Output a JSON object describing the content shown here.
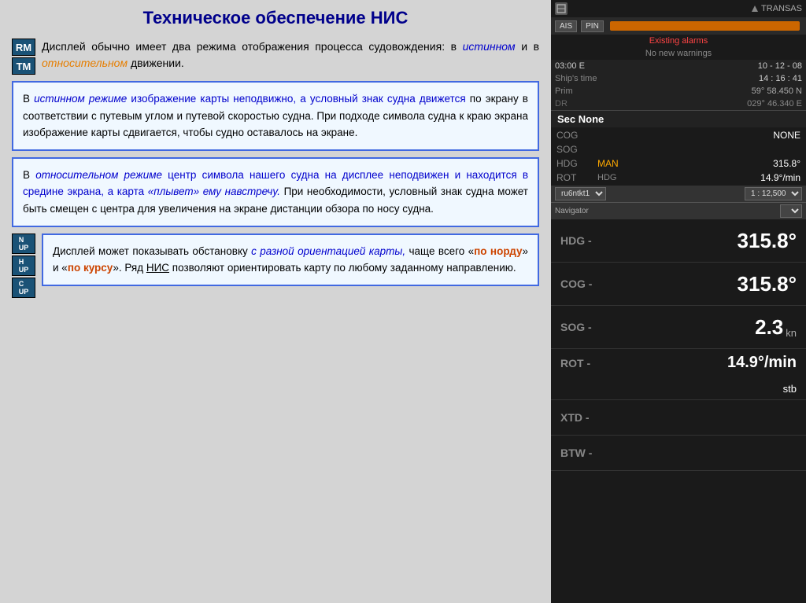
{
  "page": {
    "title": "Техническое обеспечение НИС"
  },
  "left": {
    "intro_text": "Дисплей обычно имеет два режима отображения процесса судовождения: в ",
    "intro_text2": "истинном",
    "intro_text3": " и в ",
    "intro_text4": "относительном",
    "intro_text5": " движении.",
    "side_buttons": [
      {
        "label": "RM"
      },
      {
        "label": "TM"
      }
    ],
    "box1_text_parts": [
      {
        "text": "В ",
        "style": "normal"
      },
      {
        "text": "истинном режиме",
        "style": "italic-blue"
      },
      {
        "text": " изображение карты неподвижно, а условный знак судна движется",
        "style": "blue"
      },
      {
        "text": " по экрану в соответствии с путевым углом и путевой скоростью судна. При подходе символа судна к краю экрана изображение карты сдвигается, чтобы судно оставалось на экране.",
        "style": "normal"
      }
    ],
    "box2_text_parts": [
      {
        "text": "В ",
        "style": "normal"
      },
      {
        "text": "относительном режиме",
        "style": "italic-blue"
      },
      {
        "text": " центр символа нашего судна на дисплее неподвижен и находится в средине экрана, а карта ",
        "style": "blue"
      },
      {
        "text": "«плывет» ему навстречу.",
        "style": "italic-blue"
      },
      {
        "text": " При необходимости, условный знак судна может быть смещен с центра для увеличения на экране дистанции обзора по носу судна.",
        "style": "normal"
      }
    ],
    "bottom_buttons": [
      {
        "label": "N UP"
      },
      {
        "label": "H UP"
      },
      {
        "label": "C UP"
      }
    ],
    "box3_text_parts": [
      {
        "text": "Дисплей может показывать обстановку ",
        "style": "normal"
      },
      {
        "text": "с разной ориентацией карты,",
        "style": "italic-blue"
      },
      {
        "text": " чаще всего «",
        "style": "normal"
      },
      {
        "text": "по норду",
        "style": "bold-orange"
      },
      {
        "text": "» и «",
        "style": "normal"
      },
      {
        "text": "по курсу",
        "style": "bold-orange"
      },
      {
        "text": "». Ряд ",
        "style": "normal"
      },
      {
        "text": "НИС",
        "style": "underline"
      },
      {
        "text": " позволяют ориентировать карту по любому заданному направлению.",
        "style": "normal"
      }
    ]
  },
  "right": {
    "logo": "TRANSAS",
    "ais_label": "AIS",
    "pin_label": "PIN",
    "alarm_label": "Existing alarms",
    "warning_label": "No new warnings",
    "time_utc": "03:00 E",
    "date": "10 - 12 - 08",
    "ships_time_label": "Ship's time",
    "ships_time": "14 : 16 : 41",
    "prim_label": "Prim",
    "prim_lat": "59° 58.450 N",
    "dr_label": "DR",
    "dr_lon": "029° 46.340 E",
    "sec_none": "Sec None",
    "cog_label": "COG",
    "cog_value": "NONE",
    "sog_label": "SOG",
    "hdg_label": "HDG",
    "hdg_mode": "MAN",
    "hdg_value": "315.8°",
    "rot_label": "ROT",
    "rot_mode": "HDG",
    "rot_value": "14.9°/min",
    "chart_id": "ru6ntkt1",
    "scale": "1 : 12,500",
    "navigator_label": "Navigator",
    "big_hdg_label": "HDG -",
    "big_hdg_value": "315.8°",
    "big_cog_label": "COG -",
    "big_cog_value": "315.8°",
    "big_sog_label": "SOG -",
    "big_sog_value": "2.3",
    "big_sog_unit": "kn",
    "big_rot_label": "ROT -",
    "big_rot_value": "14.9°/min",
    "big_rot_sub": "stb",
    "big_xtd_label": "XTD -",
    "big_btw_label": "BTW -"
  }
}
